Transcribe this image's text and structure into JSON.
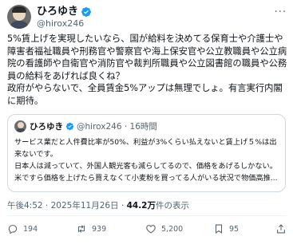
{
  "author": {
    "display_name": "ひろゆき",
    "handle": "@hirox246"
  },
  "tweet": {
    "text": "5%賃上げを実現したいなら、国が給料を決めてる保育士や介護士や障害者福祉職員や刑務官や警察官や海上保安官や公立教職員や公立病院の看護師や自衛官や消防官や裁判所職員や公立図書館の職員や公務員の給料をあげれば良くね？\n政府がやらないで、全員賃金5%アップは無理でしょ。有言実行内閣に期待。"
  },
  "quoted_tweet": {
    "display_name": "ひろゆき",
    "handle": "@hirox246",
    "time": "16時間",
    "text": "サービス業だと人件費比率が50%、利益が3%くらい払えないと賃上げ５%は出来ないです。\n日本人は減っていて、外国人観光客も減らしてるので、価格をあげるしかない。\n米ですら価格を上げたら買えなくて小麦粉を買ってる人がいる状況で物価高推..."
  },
  "meta": {
    "time": "午後4:52",
    "date": "2025年11月26日",
    "views": "44.2万",
    "views_label": "件の表示"
  },
  "actions": {
    "replies": "194",
    "retweets": "939",
    "likes": "5,200",
    "bookmarks": "95"
  },
  "icons": {
    "verified": "verified-badge-icon",
    "more": "more-dots-icon",
    "reply": "reply-icon",
    "retweet": "retweet-icon",
    "like": "heart-icon",
    "bookmark": "bookmark-icon",
    "share": "share-icon"
  },
  "colors": {
    "verified": "#1d9bf0",
    "text": "#0f1419",
    "secondary": "#536471",
    "border": "#cfd9de"
  }
}
